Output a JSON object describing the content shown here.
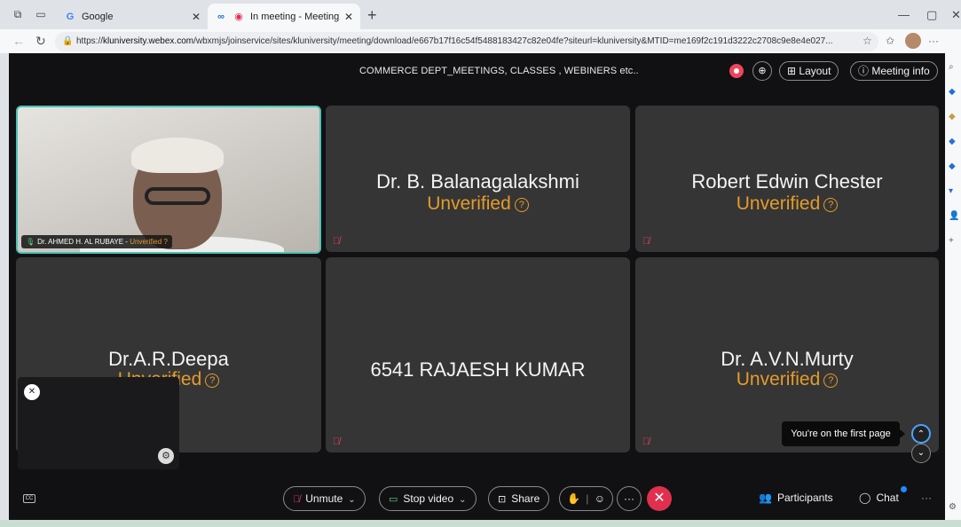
{
  "browser": {
    "tabs": [
      {
        "title": "Google",
        "favicon": "G",
        "active": false
      },
      {
        "title": "In meeting - Meeting - Webe",
        "favicon": "∞",
        "active": true
      }
    ],
    "url_prefix": "https://",
    "url_host": "kluniversity.webex.com",
    "url_path": "/wbxmjs/joinservice/sites/kluniversity/meeting/download/e667b17f16c54f5488183427c82e04fe?siteurl=kluniversity&MTID=me169f2c191d3222c2708c9e8e4e027..."
  },
  "meeting": {
    "title": "COMMERCE DEPT_MEETINGS, CLASSES , WEBINERS etc..",
    "layout_label": "Layout",
    "meeting_info_label": "Meeting info",
    "participants_tiles": [
      {
        "name": "Dr. AHMED H. AL RUBAYE",
        "status": "Unverified",
        "video": true
      },
      {
        "name": "Dr. B. Balanagalakshmi",
        "status": "Unverified"
      },
      {
        "name": "Robert Edwin Chester",
        "status": "Unverified"
      },
      {
        "name": "Dr.A.R.Deepa",
        "status": "Unverified"
      },
      {
        "name": "6541 RAJAESH KUMAR",
        "status": ""
      },
      {
        "name": "Dr. A.V.N.Murty",
        "status": "Unverified"
      }
    ],
    "tooltip": "You're on the first page",
    "controls": {
      "unmute": "Unmute",
      "stop_video": "Stop video",
      "share": "Share",
      "participants": "Participants",
      "chat": "Chat"
    },
    "colors": {
      "unverified": "#e49b2b",
      "leave": "#e0304e",
      "active_speaker_border": "#49c3b5",
      "recording": "#f0445c"
    }
  }
}
